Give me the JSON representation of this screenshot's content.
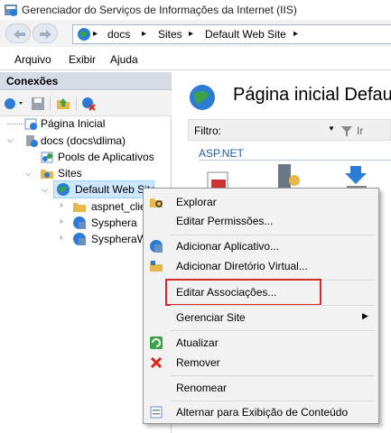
{
  "window": {
    "title": "Gerenciador do Serviços de Informações da Internet (IIS)"
  },
  "address": {
    "crumbs": [
      "docs",
      "Sites",
      "Default Web Site"
    ],
    "separator": "▸"
  },
  "menu": {
    "items": [
      "Arquivo",
      "Exibir",
      "Ajuda"
    ]
  },
  "connections": {
    "header": "Conexões",
    "tree": [
      {
        "label": "Página Inicial"
      },
      {
        "label": "docs (docs\\dlima)"
      },
      {
        "label": "Pools de Aplicativos"
      },
      {
        "label": "Sites"
      },
      {
        "label": "Default Web Site"
      },
      {
        "label": "aspnet_clie"
      },
      {
        "label": "Syspher‌a"
      },
      {
        "label": "SyspheraW"
      }
    ]
  },
  "main": {
    "title": "Página inicial Default",
    "filter_label": "Filtro:",
    "go_label": "Ir",
    "group_label": "ASP.NET"
  },
  "context_menu": {
    "items": [
      "Explorar",
      "Editar Permissões...",
      "Adicionar Aplicativo...",
      "Adicionar Diretório Virtual...",
      "Editar Associações...",
      "Gerenciar Site",
      "Atualizar",
      "Remover",
      "Renomear",
      "Alternar para Exibição de Conteúdo"
    ],
    "highlighted": "Editar Associações...",
    "highlight_color": "#d62a2a"
  },
  "colors": {
    "pane_header": "#d6dbe6",
    "folder": "#e8b94a",
    "globe": "#2c7bd6"
  }
}
